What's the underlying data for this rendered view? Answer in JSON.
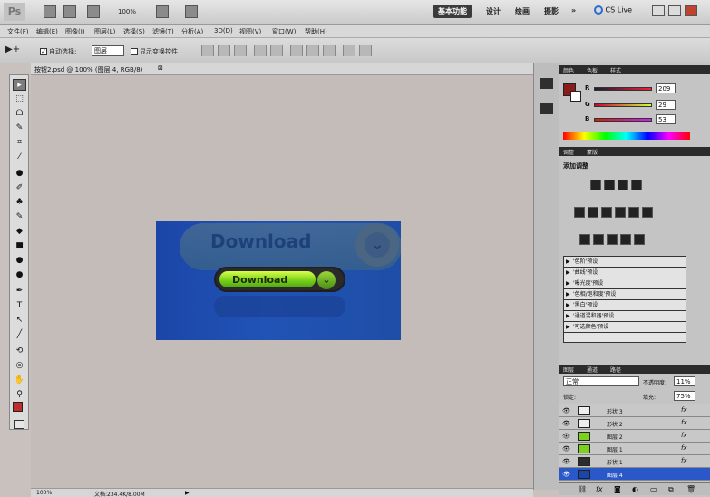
{
  "app": {
    "logo": "Ps",
    "zoom_select": "100%",
    "workspaces": [
      "基本功能",
      "设计",
      "绘画",
      "摄影",
      "»"
    ],
    "active_workspace": "基本功能",
    "cslive": "CS Live"
  },
  "menubar": [
    "文件(F)",
    "编辑(E)",
    "图像(I)",
    "图层(L)",
    "选择(S)",
    "滤镜(T)",
    "分析(A)",
    "3D(D)",
    "视图(V)",
    "窗口(W)",
    "帮助(H)"
  ],
  "options": {
    "auto_select_label": "自动选择:",
    "auto_select_value": "图层",
    "show_transform_label": "显示变换控件"
  },
  "document": {
    "tab_title": "按钮2.psd @ 100% (图层 4, RGB/8)",
    "button_text": "Download",
    "ghost_text": "Download"
  },
  "statusbar": {
    "zoom": "100%",
    "doc_info": "文档:234.4K/8.00M"
  },
  "color_panel": {
    "tabs": [
      "颜色",
      "色板",
      "样式"
    ],
    "fg_color": "#8b1c1c",
    "channels": [
      {
        "label": "R",
        "value": "209"
      },
      {
        "label": "G",
        "value": "29"
      },
      {
        "label": "B",
        "value": "53"
      }
    ]
  },
  "adjust_panel": {
    "tabs": [
      "调整",
      "蒙版"
    ],
    "title": "添加调整",
    "presets": [
      "'色阶'预设",
      "'曲线'预设",
      "'曝光度'预设",
      "'色相/饱和度'预设",
      "'黑白'预设",
      "'通道混和器'预设",
      "'可选颜色'预设"
    ]
  },
  "layers_panel": {
    "tabs": [
      "图层",
      "通道",
      "路径"
    ],
    "blend_mode": "正常",
    "opacity_label": "不透明度:",
    "opacity_value": "11%",
    "lock_label": "锁定:",
    "fill_label": "填充:",
    "fill_value": "75%",
    "layers": [
      {
        "name": "形状 3",
        "fx": "fx"
      },
      {
        "name": "形状 2",
        "fx": "fx"
      },
      {
        "name": "图层 2",
        "fx": "fx"
      },
      {
        "name": "图层 1",
        "fx": "fx"
      },
      {
        "name": "形状 1",
        "fx": "fx"
      },
      {
        "name": "图层 4",
        "fx": ""
      }
    ]
  }
}
